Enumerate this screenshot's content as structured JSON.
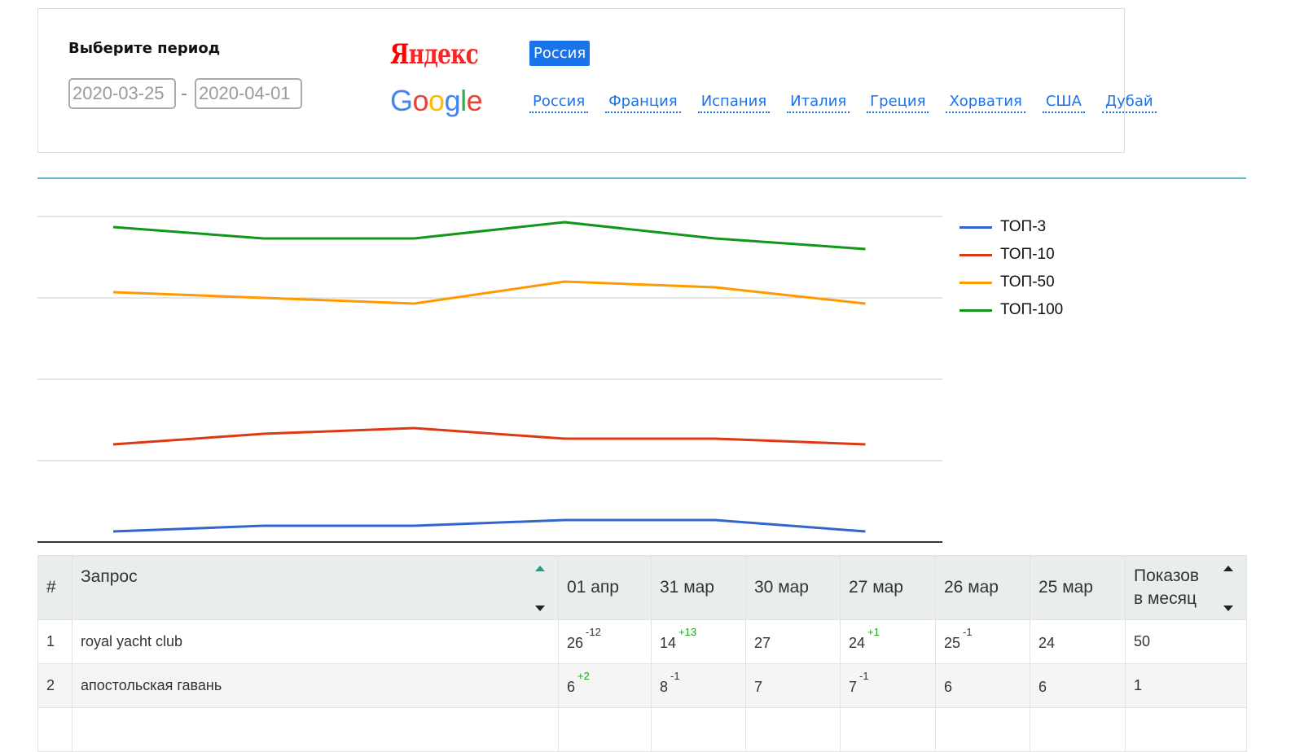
{
  "period": {
    "label": "Выберите период",
    "date_from": "2020-03-25",
    "separator": "-",
    "date_to": "2020-04-01"
  },
  "engines": {
    "yandex_logo": "Яндекс",
    "google_logo": "Google",
    "yandex_regions": [
      "Россия"
    ],
    "google_regions": [
      "Россия",
      "Франция",
      "Испания",
      "Италия",
      "Греция",
      "Хорватия",
      "США",
      "Дубай"
    ]
  },
  "chart_data": {
    "type": "line",
    "title": "",
    "xlabel": "",
    "ylabel": "",
    "ylim": [
      0,
      4
    ],
    "grid": true,
    "legend_position": "right",
    "x": [
      1,
      2,
      3,
      4,
      5,
      6
    ],
    "series": [
      {
        "name": "ТОП-3",
        "color": "#3366cc",
        "values": [
          0.13,
          0.2,
          0.2,
          0.27,
          0.27,
          0.13
        ]
      },
      {
        "name": "ТОП-10",
        "color": "#dc3912",
        "values": [
          1.2,
          1.33,
          1.4,
          1.27,
          1.27,
          1.2
        ]
      },
      {
        "name": "ТОП-50",
        "color": "#ff9900",
        "values": [
          3.07,
          3.0,
          2.93,
          3.2,
          3.13,
          2.93
        ]
      },
      {
        "name": "ТОП-100",
        "color": "#109618",
        "values": [
          3.87,
          3.73,
          3.73,
          3.93,
          3.73,
          3.6
        ]
      }
    ]
  },
  "table": {
    "headers": {
      "num": "#",
      "query": "Запрос",
      "d1": "01 апр",
      "d2": "31 мар",
      "d3": "30 мар",
      "d4": "27 мар",
      "d5": "26 мар",
      "d6": "25 мар",
      "shows_line1": "Показов",
      "shows_line2": "в месяц"
    },
    "rows": [
      {
        "num": "1",
        "query": "royal yacht club",
        "d1": "26",
        "d1_delta": "-12",
        "d2": "14",
        "d2_delta": "+13",
        "d3": "27",
        "d3_delta": "",
        "d4": "24",
        "d4_delta": "+1",
        "d5": "25",
        "d5_delta": "-1",
        "d6": "24",
        "d6_delta": "",
        "shows": "50"
      },
      {
        "num": "2",
        "query": "апостольская гавань",
        "d1": "6",
        "d1_delta": "+2",
        "d2": "8",
        "d2_delta": "-1",
        "d3": "7",
        "d3_delta": "",
        "d4": "7",
        "d4_delta": "-1",
        "d5": "6",
        "d5_delta": "",
        "d6": "6",
        "d6_delta": "",
        "shows": "1"
      },
      {
        "num": "",
        "query": "",
        "d1": "",
        "d1_delta": "",
        "d2": "",
        "d2_delta": "",
        "d3": "",
        "d3_delta": "",
        "d4": "",
        "d4_delta": "",
        "d5": "",
        "d5_delta": "",
        "d6": "",
        "d6_delta": "",
        "shows": ""
      }
    ]
  }
}
